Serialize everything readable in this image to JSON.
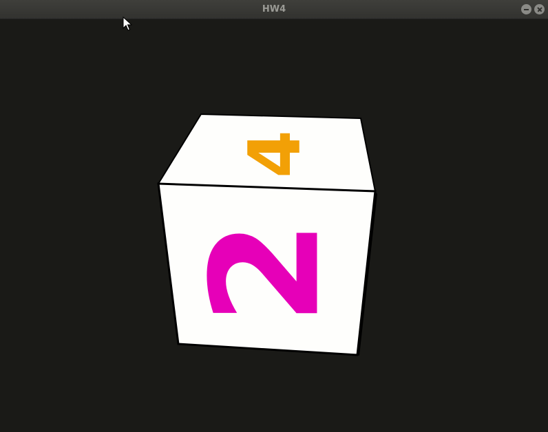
{
  "window": {
    "title": "HW4"
  },
  "scene": {
    "background_color": "#1a1a17",
    "cube": {
      "front_face_label": "2",
      "front_face_color": "#e600b8",
      "top_face_label": "4",
      "top_face_color": "#f2a006",
      "face_fill": "#fefefc"
    }
  },
  "icons": {
    "minimize": "minimize-icon",
    "close": "close-icon",
    "cursor": "mouse-pointer-icon"
  }
}
